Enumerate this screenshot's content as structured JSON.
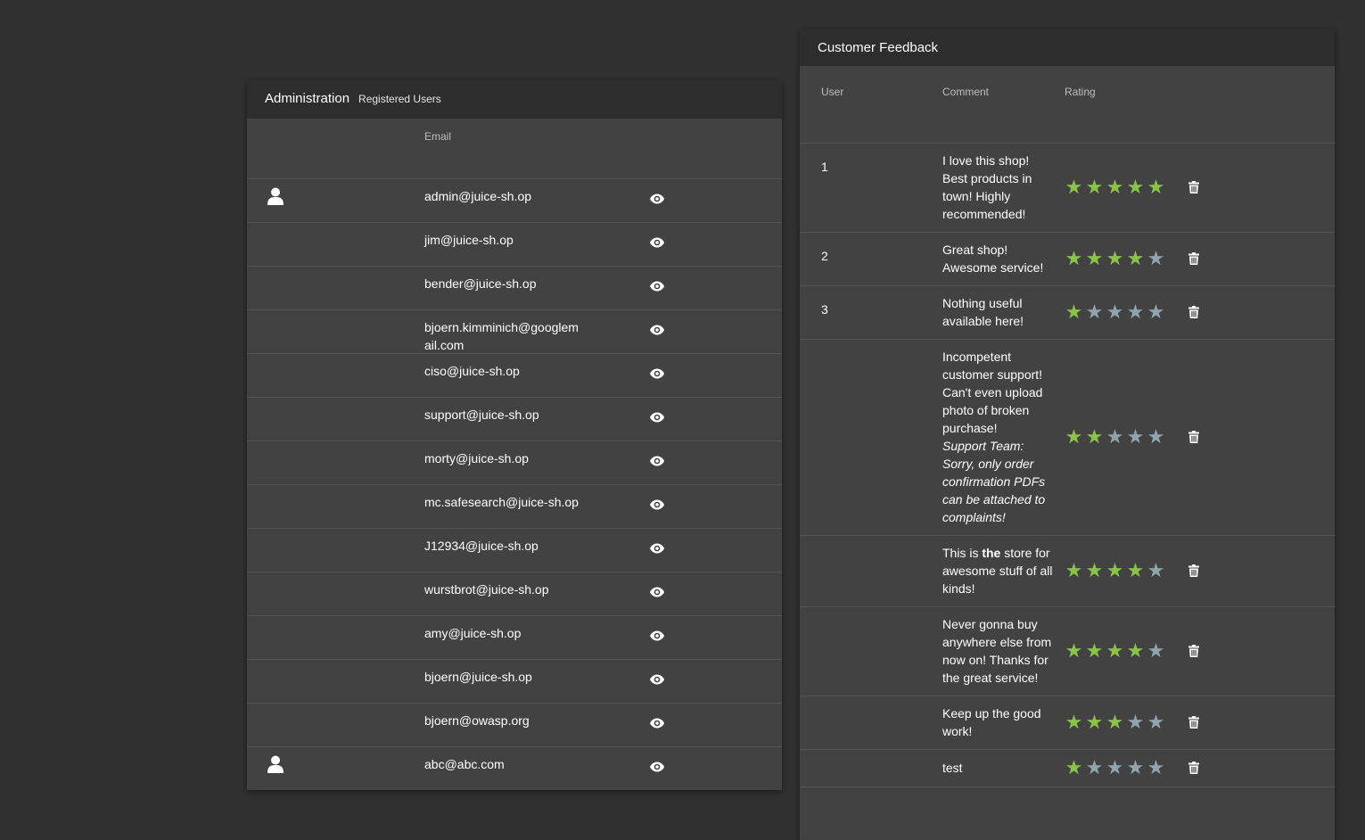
{
  "admin": {
    "title": "Administration",
    "subtitle": "Registered Users",
    "column_email": "Email",
    "users": [
      {
        "email": "admin@juice-sh.op",
        "has_avatar": true
      },
      {
        "email": "jim@juice-sh.op",
        "has_avatar": false
      },
      {
        "email": "bender@juice-sh.op",
        "has_avatar": false
      },
      {
        "email": "bjoern.kimminich@googlemail.com",
        "has_avatar": false
      },
      {
        "email": "ciso@juice-sh.op",
        "has_avatar": false
      },
      {
        "email": "support@juice-sh.op",
        "has_avatar": false
      },
      {
        "email": "morty@juice-sh.op",
        "has_avatar": false
      },
      {
        "email": "mc.safesearch@juice-sh.op",
        "has_avatar": false
      },
      {
        "email": "J12934@juice-sh.op",
        "has_avatar": false
      },
      {
        "email": "wurstbrot@juice-sh.op",
        "has_avatar": false
      },
      {
        "email": "amy@juice-sh.op",
        "has_avatar": false
      },
      {
        "email": "bjoern@juice-sh.op",
        "has_avatar": false
      },
      {
        "email": "bjoern@owasp.org",
        "has_avatar": false
      },
      {
        "email": "abc@abc.com",
        "has_avatar": true
      }
    ]
  },
  "feedback": {
    "title": "Customer Feedback",
    "column_user": "User",
    "column_comment": "Comment",
    "column_rating": "Rating",
    "rows": [
      {
        "user": "1",
        "comment": "I love this shop! Best products in town! Highly recommended!",
        "rating": 5
      },
      {
        "user": "2",
        "comment": "Great shop! Awesome service!",
        "rating": 4
      },
      {
        "user": "3",
        "comment": "Nothing useful available here!",
        "rating": 1
      },
      {
        "user": "",
        "comment": "Incompetent customer support! Can't even upload photo of broken purchase!",
        "reply": "Support Team: Sorry, only order confirmation PDFs can be attached to complaints!",
        "rating": 2
      },
      {
        "user": "",
        "comment_before": "This is ",
        "comment_bold": "the",
        "comment_after": " store for awesome stuff of all kinds!",
        "rating": 4
      },
      {
        "user": "",
        "comment": "Never gonna buy anywhere else from now on! Thanks for the great service!",
        "rating": 4
      },
      {
        "user": "",
        "comment": "Keep up the good work!",
        "rating": 3
      },
      {
        "user": "",
        "comment": "test",
        "rating": 1
      }
    ]
  },
  "colors": {
    "background": "#303030",
    "card": "#424242",
    "card_header": "#2d2d2d",
    "star_on": "#8bc34a",
    "star_off": "#90a4ae"
  },
  "icons": {
    "avatar": "user-icon",
    "view": "eye-icon",
    "delete": "trash-icon",
    "star": "star-icon"
  }
}
